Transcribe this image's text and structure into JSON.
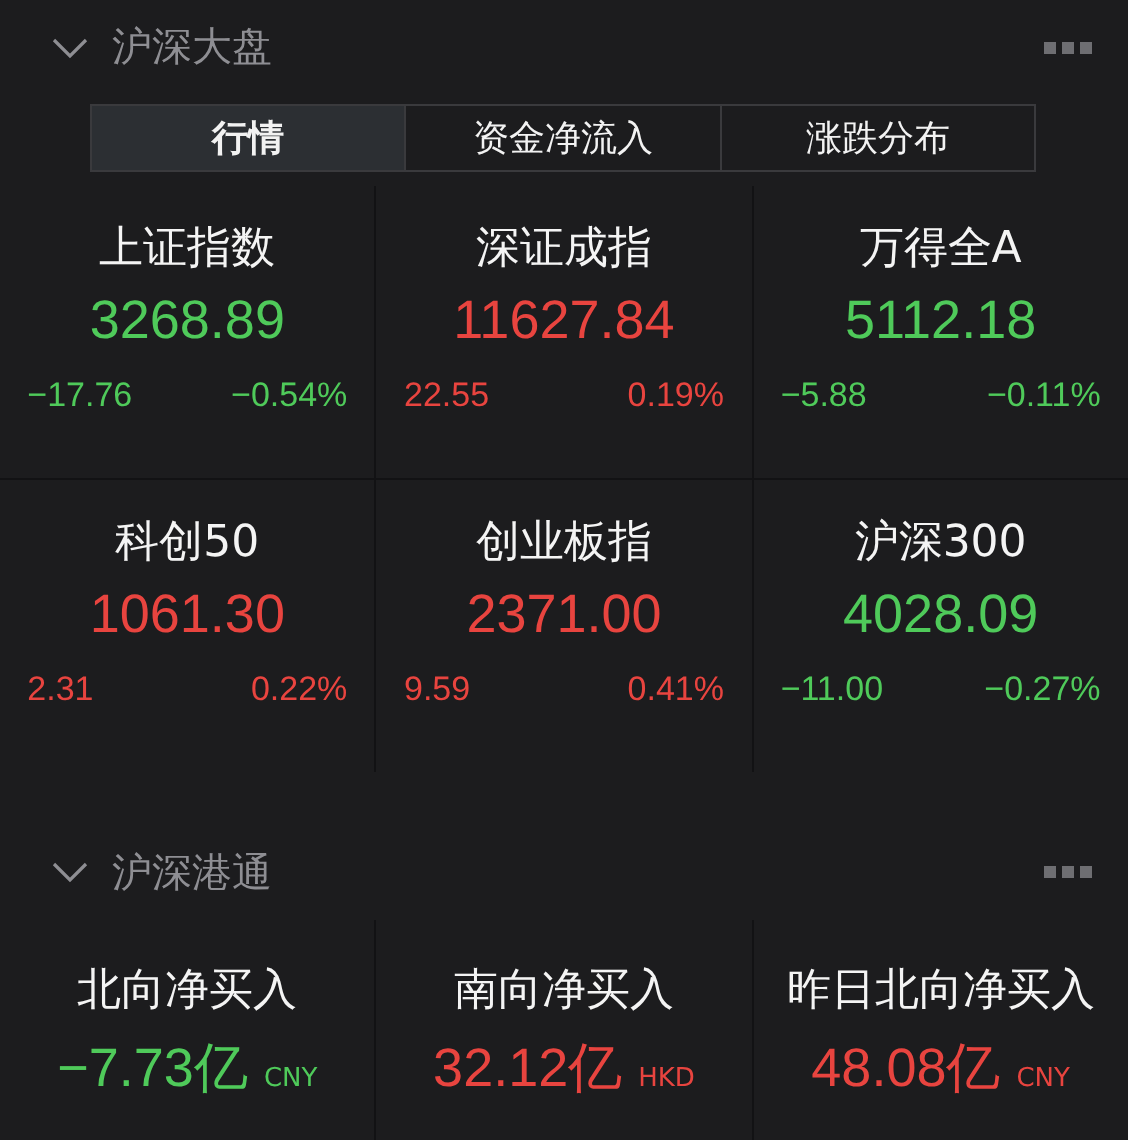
{
  "sections": [
    {
      "title": "沪深大盘",
      "expanded": true,
      "tabs": [
        {
          "label": "行情",
          "selected": true
        },
        {
          "label": "资金净流入",
          "selected": false
        },
        {
          "label": "涨跌分布",
          "selected": false
        }
      ],
      "indices": [
        {
          "name": "上证指数",
          "value": "3268.89",
          "change": "−17.76",
          "percent": "−0.54%",
          "color": "#4fca5a"
        },
        {
          "name": "深证成指",
          "value": "11627.84",
          "change": "22.55",
          "percent": "0.19%",
          "color": "#e8443f"
        },
        {
          "name": "万得全A",
          "value": "5112.18",
          "change": "−5.88",
          "percent": "−0.11%",
          "color": "#4fca5a"
        },
        {
          "name": "科创50",
          "value": "1061.30",
          "change": "2.31",
          "percent": "0.22%",
          "color": "#e8443f"
        },
        {
          "name": "创业板指",
          "value": "2371.00",
          "change": "9.59",
          "percent": "0.41%",
          "color": "#e8443f"
        },
        {
          "name": "沪深300",
          "value": "4028.09",
          "change": "−11.00",
          "percent": "−0.27%",
          "color": "#4fca5a"
        }
      ]
    },
    {
      "title": "沪深港通",
      "expanded": true,
      "flows": [
        {
          "name": "北向净买入",
          "value": "−7.73亿",
          "currency": "CNY",
          "color": "#4fca5a"
        },
        {
          "name": "南向净买入",
          "value": "32.12亿",
          "currency": "HKD",
          "color": "#e8443f"
        },
        {
          "name": "昨日北向净买入",
          "value": "48.08亿",
          "currency": "CNY",
          "color": "#e8443f"
        }
      ]
    }
  ]
}
